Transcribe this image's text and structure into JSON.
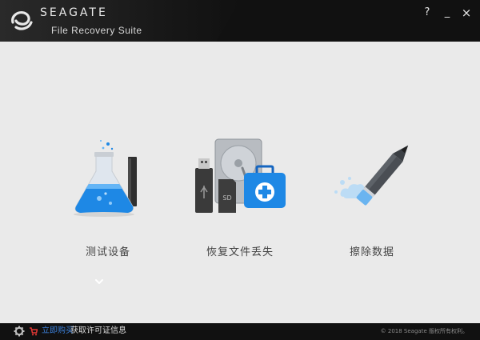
{
  "window": {
    "brand": "SEAGATE",
    "subtitle": "File Recovery Suite",
    "controls": {
      "help": "?",
      "minimize": "_",
      "close": "×"
    }
  },
  "main": {
    "cards": [
      {
        "label": "测试设备",
        "icon": "flask-icon"
      },
      {
        "label": "恢复文件丢失",
        "icon": "recovery-icon"
      },
      {
        "label": "擦除数据",
        "icon": "pencil-icon"
      }
    ],
    "expand_icon": "chevron-down-icon"
  },
  "footer": {
    "buy_label": "立即购买",
    "license_label": "获取许可证信息",
    "copyright": "© 2018 Seagate 版权所有权利。"
  },
  "colors": {
    "titlebar": "#111111",
    "background": "#eaeaea",
    "accent": "#1e88e5",
    "link": "#3b7fd8"
  }
}
